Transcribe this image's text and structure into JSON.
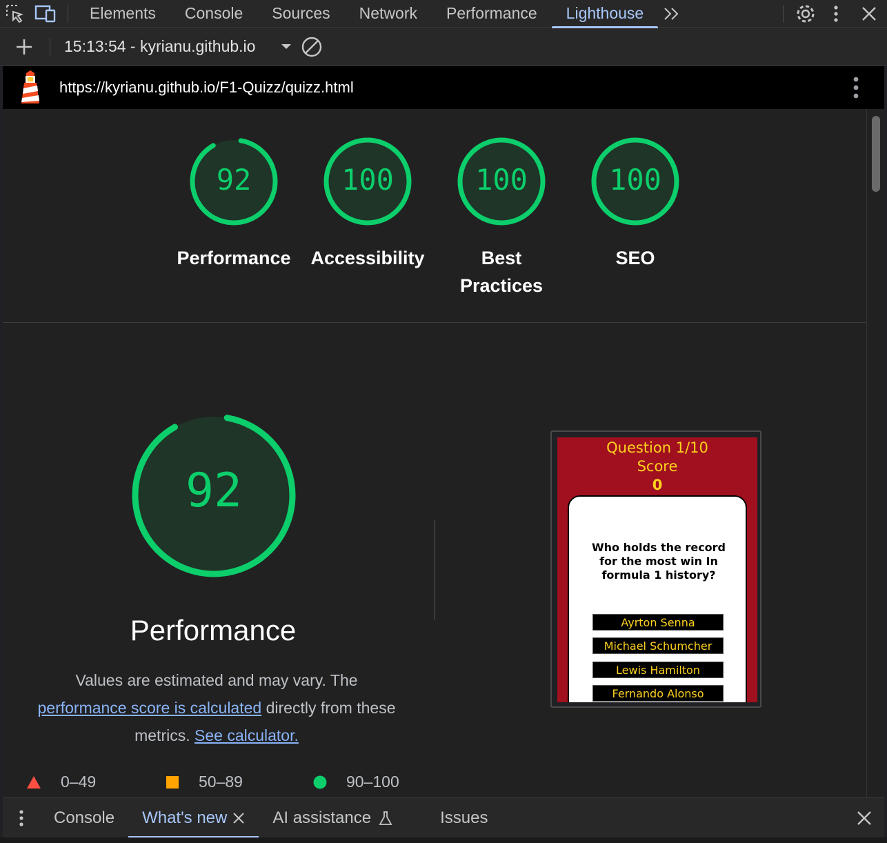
{
  "devtools": {
    "tabs": [
      "Elements",
      "Console",
      "Sources",
      "Network",
      "Performance",
      "Lighthouse"
    ],
    "active_tab": "Lighthouse"
  },
  "toolbar": {
    "report_label": "15:13:54 - kyrianu.github.io"
  },
  "url": "https://kyrianu.github.io/F1-Quizz/quizz.html",
  "scores": [
    {
      "label": "Performance",
      "value": "92",
      "fraction": 0.92
    },
    {
      "label": "Accessibility",
      "value": "100",
      "fraction": 1.0
    },
    {
      "label": "Best Practices",
      "value": "100",
      "fraction": 1.0
    },
    {
      "label": "SEO",
      "value": "100",
      "fraction": 1.0
    }
  ],
  "performance": {
    "score": "92",
    "fraction": 0.92,
    "title": "Performance",
    "desc_1": "Values are estimated and may vary. The",
    "link_1": "performance score is calculated",
    "desc_2": "directly from these",
    "desc_3": "metrics.",
    "link_2": "See calculator."
  },
  "legend": [
    {
      "range": "0–49",
      "color": "#ff4e42"
    },
    {
      "range": "50–89",
      "color": "#ffa400"
    },
    {
      "range": "90–100",
      "color": "#0cce6b"
    }
  ],
  "thumbnail": {
    "question_label": "Question 1/10",
    "score_label": "Score",
    "score_value": "0",
    "question": "Who holds the record for the most win In formula 1 history?",
    "answers": [
      "Ayrton Senna",
      "Michael Schumcher",
      "Lewis Hamilton",
      "Fernando Alonso"
    ]
  },
  "drawer": {
    "tabs": [
      "Console",
      "What's new",
      "AI assistance",
      "Issues"
    ],
    "active_tab": "What's new"
  },
  "colors": {
    "pass": "#0cce6b",
    "accent": "#a8c7fa",
    "link": "#8ab4f8"
  }
}
